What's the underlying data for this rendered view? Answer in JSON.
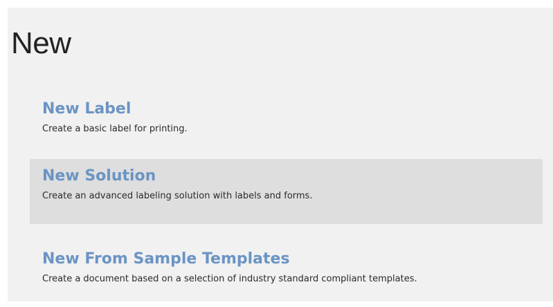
{
  "page": {
    "title": "New"
  },
  "options": [
    {
      "title": "New Label",
      "description": "Create a basic label for printing.",
      "selected": false
    },
    {
      "title": "New Solution",
      "description": "Create an advanced labeling solution with labels and forms.",
      "selected": true
    },
    {
      "title": "New From Sample Templates",
      "description": "Create a document based on a selection of industry standard compliant templates.",
      "selected": false
    }
  ],
  "colors": {
    "panel_background": "#f1f1f1",
    "selected_background": "#dedede",
    "accent_link": "#6b94c4",
    "text": "#2a2a2a"
  }
}
